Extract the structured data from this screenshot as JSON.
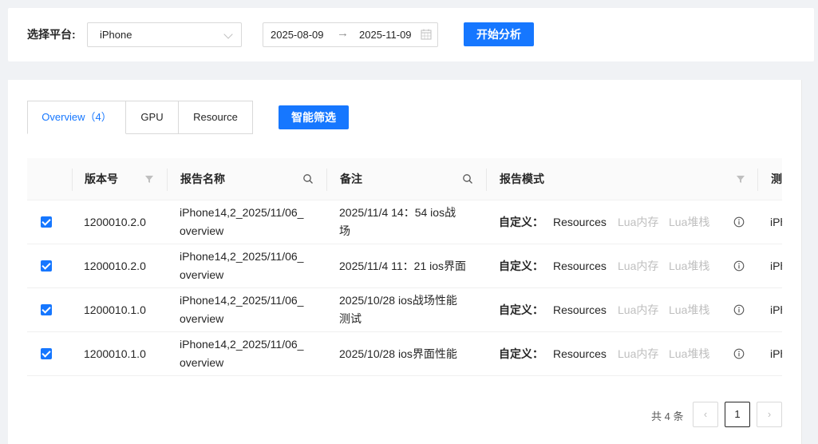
{
  "filter": {
    "platform_label": "选择平台:",
    "platform_value": "iPhone",
    "date_start": "2025-08-09",
    "date_arrow": "→",
    "date_end": "2025-11-09",
    "start_button": "开始分析"
  },
  "tabs": [
    {
      "label": "Overview（4）",
      "active": true
    },
    {
      "label": "GPU",
      "active": false
    },
    {
      "label": "Resource",
      "active": false
    }
  ],
  "smart_filter_button": "智能筛选",
  "table": {
    "columns": [
      "版本号",
      "报告名称",
      "备注",
      "报告模式",
      "测"
    ],
    "mode_label": "自定义：",
    "mode_tags": [
      "Resources",
      "Lua内存",
      "Lua堆栈"
    ],
    "rows": [
      {
        "checked": true,
        "version": "1200010.2.0",
        "name_line1": "iPhone14,2_2025/11/06_",
        "name_line2": "overview",
        "remark_line1": "2025/11/4 14：54 ios战",
        "remark_line2": "场",
        "device": "iPh"
      },
      {
        "checked": true,
        "version": "1200010.2.0",
        "name_line1": "iPhone14,2_2025/11/06_",
        "name_line2": "overview",
        "remark_line1": "2025/11/4 11：21 ios界面",
        "remark_line2": "",
        "device": "iPh"
      },
      {
        "checked": true,
        "version": "1200010.1.0",
        "name_line1": "iPhone14,2_2025/11/06_",
        "name_line2": "overview",
        "remark_line1": "2025/10/28 ios战场性能",
        "remark_line2": "测试",
        "device": "iPh"
      },
      {
        "checked": true,
        "version": "1200010.1.0",
        "name_line1": "iPhone14,2_2025/11/06_",
        "name_line2": "overview",
        "remark_line1": "2025/10/28 ios界面性能",
        "remark_line2": "",
        "device": "iPh"
      }
    ]
  },
  "pagination": {
    "total": "共 4 条",
    "prev": "‹",
    "current": "1",
    "next": "›"
  },
  "colors": {
    "primary": "#1677ff",
    "disabled_text": "#bfbfbf"
  }
}
